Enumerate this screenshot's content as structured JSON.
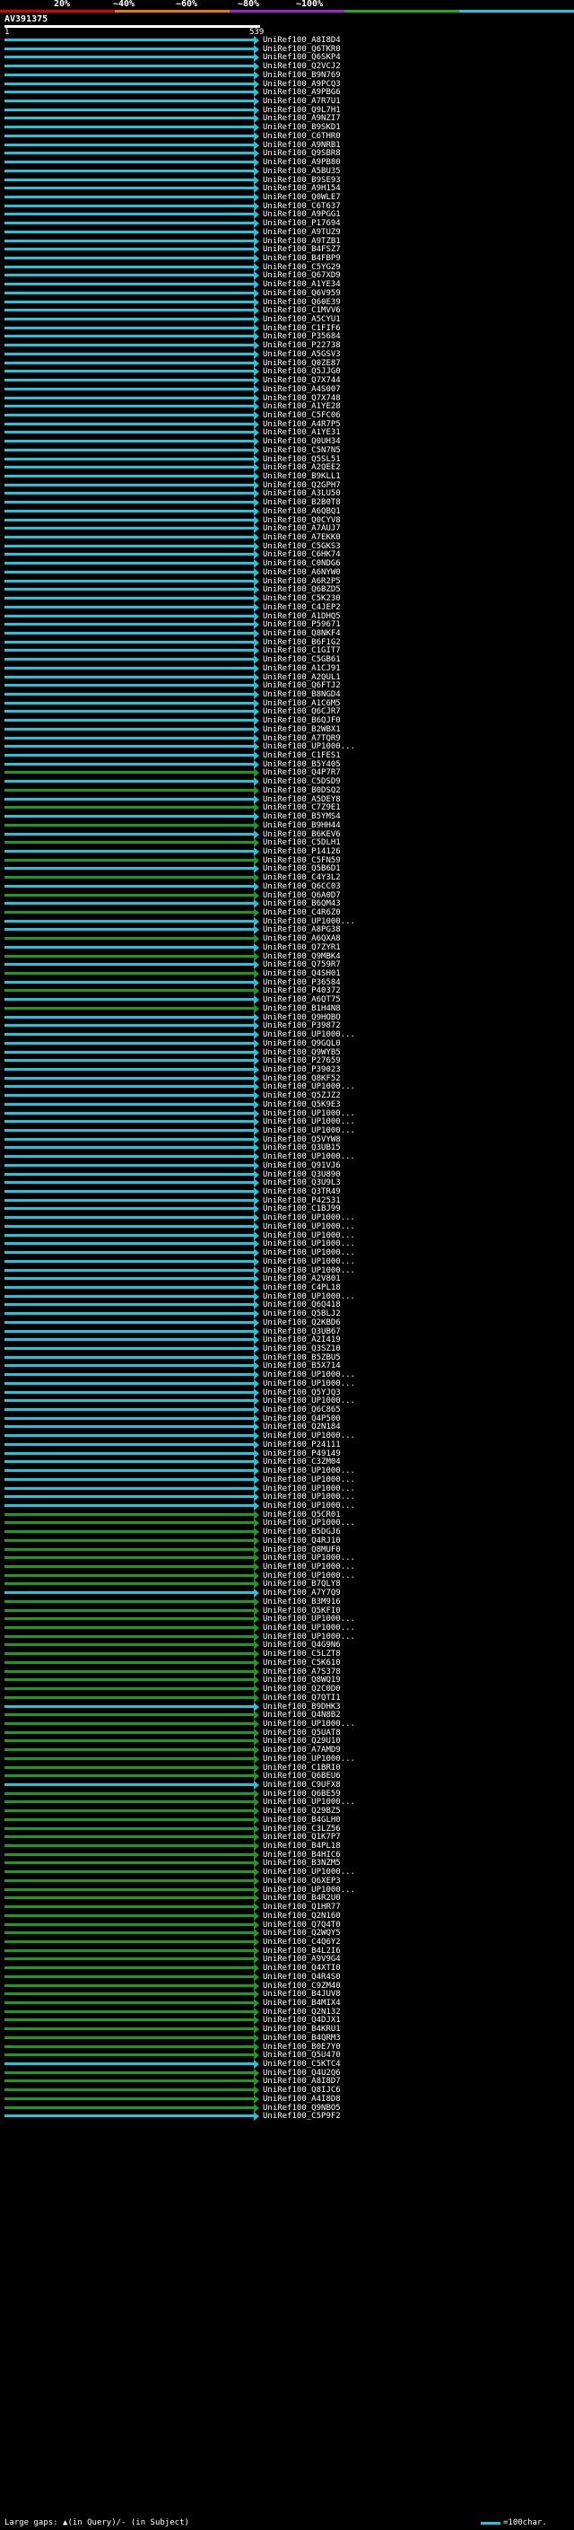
{
  "legend": {
    "labels": [
      "20%",
      "~40%",
      "~60%",
      "~80%",
      "~100%"
    ],
    "colors": [
      "#dd0000",
      "#ee7700",
      "#9922cc",
      "#22aa22",
      "#22c4dc"
    ]
  },
  "query": {
    "title": "AV391375",
    "start": "1",
    "end": "539"
  },
  "colors": {
    "cyan": "#22c4dc",
    "green": "#1f9a1f",
    "white": "#ffffff",
    "black": "#000000"
  },
  "hits": [
    {
      "label": "UniRef100_A8I8D4",
      "color": "cyan"
    },
    {
      "label": "UniRef100_Q6TKR0",
      "color": "cyan"
    },
    {
      "label": "UniRef100_Q6SKP4",
      "color": "cyan"
    },
    {
      "label": "UniRef100_Q2VCJ2",
      "color": "cyan"
    },
    {
      "label": "UniRef100_B9N769",
      "color": "cyan"
    },
    {
      "label": "UniRef100_A9PCQ3",
      "color": "cyan"
    },
    {
      "label": "UniRef100_A9PBG6",
      "color": "cyan"
    },
    {
      "label": "UniRef100_A7R7U1",
      "color": "cyan"
    },
    {
      "label": "UniRef100_Q9L7H1",
      "color": "cyan"
    },
    {
      "label": "UniRef100_A9NZI7",
      "color": "cyan"
    },
    {
      "label": "UniRef100_B9SKD1",
      "color": "cyan"
    },
    {
      "label": "UniRef100_C6THR0",
      "color": "cyan"
    },
    {
      "label": "UniRef100_A9NRB1",
      "color": "cyan"
    },
    {
      "label": "UniRef100_Q9SBR8",
      "color": "cyan"
    },
    {
      "label": "UniRef100_A9PB80",
      "color": "cyan"
    },
    {
      "label": "UniRef100_A5BU35",
      "color": "cyan"
    },
    {
      "label": "UniRef100_B9SE93",
      "color": "cyan"
    },
    {
      "label": "UniRef100_A9H154",
      "color": "cyan"
    },
    {
      "label": "UniRef100_Q0WLE7",
      "color": "cyan"
    },
    {
      "label": "UniRef100_C6T637",
      "color": "cyan"
    },
    {
      "label": "UniRef100_A9PGG1",
      "color": "cyan"
    },
    {
      "label": "UniRef100_P17694",
      "color": "cyan"
    },
    {
      "label": "UniRef100_A9TUZ9",
      "color": "cyan"
    },
    {
      "label": "UniRef100_A9TZB1",
      "color": "cyan"
    },
    {
      "label": "UniRef100_B4FSZ7",
      "color": "cyan"
    },
    {
      "label": "UniRef100_B4FBP9",
      "color": "cyan"
    },
    {
      "label": "UniRef100_C5YG29",
      "color": "cyan"
    },
    {
      "label": "UniRef100_Q67XD9",
      "color": "cyan"
    },
    {
      "label": "UniRef100_A1YE34",
      "color": "cyan"
    },
    {
      "label": "UniRef100_Q6V959",
      "color": "cyan"
    },
    {
      "label": "UniRef100_Q60E39",
      "color": "cyan"
    },
    {
      "label": "UniRef100_C1MVV6",
      "color": "cyan"
    },
    {
      "label": "UniRef100_A5CYU1",
      "color": "cyan"
    },
    {
      "label": "UniRef100_C1FIF6",
      "color": "cyan"
    },
    {
      "label": "UniRef100_P35684",
      "color": "cyan"
    },
    {
      "label": "UniRef100_P22738",
      "color": "cyan"
    },
    {
      "label": "UniRef100_A5GSV3",
      "color": "cyan"
    },
    {
      "label": "UniRef100_Q0ZE87",
      "color": "cyan"
    },
    {
      "label": "UniRef100_Q5JJG0",
      "color": "cyan"
    },
    {
      "label": "UniRef100_Q7X744",
      "color": "cyan"
    },
    {
      "label": "UniRef100_A4S007",
      "color": "cyan"
    },
    {
      "label": "UniRef100_Q7X748",
      "color": "cyan"
    },
    {
      "label": "UniRef100_A1YE28",
      "color": "cyan"
    },
    {
      "label": "UniRef100_C5FC06",
      "color": "cyan"
    },
    {
      "label": "UniRef100_A4R7P5",
      "color": "cyan"
    },
    {
      "label": "UniRef100_A1YE31",
      "color": "cyan"
    },
    {
      "label": "UniRef100_Q0UH34",
      "color": "cyan"
    },
    {
      "label": "UniRef100_C5N7N5",
      "color": "cyan"
    },
    {
      "label": "UniRef100_Q5SL51",
      "color": "cyan"
    },
    {
      "label": "UniRef100_A2QEE2",
      "color": "cyan"
    },
    {
      "label": "UniRef100_B9KLL1",
      "color": "cyan"
    },
    {
      "label": "UniRef100_Q2GPH7",
      "color": "cyan"
    },
    {
      "label": "UniRef100_A3LU50",
      "color": "cyan"
    },
    {
      "label": "UniRef100_B2B0T8",
      "color": "cyan"
    },
    {
      "label": "UniRef100_A6QBQ1",
      "color": "cyan"
    },
    {
      "label": "UniRef100_Q0CYV8",
      "color": "cyan"
    },
    {
      "label": "UniRef100_A7AUJ7",
      "color": "cyan"
    },
    {
      "label": "UniRef100_A7EKK0",
      "color": "cyan"
    },
    {
      "label": "UniRef100_C5GKS3",
      "color": "cyan"
    },
    {
      "label": "UniRef100_C6HK74",
      "color": "cyan"
    },
    {
      "label": "UniRef100_C0NDG6",
      "color": "cyan"
    },
    {
      "label": "UniRef100_A6NYW0",
      "color": "cyan"
    },
    {
      "label": "UniRef100_A6R2P5",
      "color": "cyan"
    },
    {
      "label": "UniRef100_Q6BZD5",
      "color": "cyan"
    },
    {
      "label": "UniRef100_C5K230",
      "color": "cyan"
    },
    {
      "label": "UniRef100_C4JEP2",
      "color": "cyan"
    },
    {
      "label": "UniRef100_A1DHQ5",
      "color": "cyan"
    },
    {
      "label": "UniRef100_P59671",
      "color": "cyan"
    },
    {
      "label": "UniRef100_Q8NKF4",
      "color": "cyan"
    },
    {
      "label": "UniRef100_B6F1G2",
      "color": "cyan"
    },
    {
      "label": "UniRef100_C1GIT7",
      "color": "cyan"
    },
    {
      "label": "UniRef100_C5GB61",
      "color": "cyan"
    },
    {
      "label": "UniRef100_A1CJ91",
      "color": "cyan"
    },
    {
      "label": "UniRef100_A2QUL1",
      "color": "cyan"
    },
    {
      "label": "UniRef100_Q6FTJ2",
      "color": "cyan"
    },
    {
      "label": "UniRef100_B8NGD4",
      "color": "cyan"
    },
    {
      "label": "UniRef100_A1C6M5",
      "color": "cyan"
    },
    {
      "label": "UniRef100_Q6CJR7",
      "color": "cyan"
    },
    {
      "label": "UniRef100_B6QJF0",
      "color": "cyan"
    },
    {
      "label": "UniRef100_B2WBX1",
      "color": "cyan"
    },
    {
      "label": "UniRef100_A7TQR9",
      "color": "cyan"
    },
    {
      "label": "UniRef100_UP1000...",
      "color": "cyan"
    },
    {
      "label": "UniRef100_C1FES1",
      "color": "cyan"
    },
    {
      "label": "UniRef100_B5Y405",
      "color": "cyan"
    },
    {
      "label": "UniRef100_Q4P7R7",
      "color": "green"
    },
    {
      "label": "UniRef100_C5DSD9",
      "color": "cyan"
    },
    {
      "label": "UniRef100_B0DSQ2",
      "color": "green"
    },
    {
      "label": "UniRef100_A5DEY8",
      "color": "cyan"
    },
    {
      "label": "UniRef100_C7Z9E1",
      "color": "green"
    },
    {
      "label": "UniRef100_B5YMS4",
      "color": "cyan"
    },
    {
      "label": "UniRef100_B9HH44",
      "color": "green"
    },
    {
      "label": "UniRef100_B6KEV6",
      "color": "cyan"
    },
    {
      "label": "UniRef100_C5DLH1",
      "color": "green"
    },
    {
      "label": "UniRef100_P14126",
      "color": "cyan"
    },
    {
      "label": "UniRef100_C5FN59",
      "color": "green"
    },
    {
      "label": "UniRef100_Q5B6D1",
      "color": "cyan"
    },
    {
      "label": "UniRef100_C4Y3L2",
      "color": "green"
    },
    {
      "label": "UniRef100_Q6CC03",
      "color": "cyan"
    },
    {
      "label": "UniRef100_Q6A0D7",
      "color": "green"
    },
    {
      "label": "UniRef100_B6QM43",
      "color": "cyan"
    },
    {
      "label": "UniRef100_C4R6Z0",
      "color": "green"
    },
    {
      "label": "UniRef100_UP1000...",
      "color": "cyan"
    },
    {
      "label": "UniRef100_A8PG38",
      "color": "cyan"
    },
    {
      "label": "UniRef100_A6QXA8",
      "color": "green"
    },
    {
      "label": "UniRef100_Q7ZYR1",
      "color": "cyan"
    },
    {
      "label": "UniRef100_Q9MBK4",
      "color": "green"
    },
    {
      "label": "UniRef100_Q759R7",
      "color": "cyan"
    },
    {
      "label": "UniRef100_Q4SH01",
      "color": "green"
    },
    {
      "label": "UniRef100_P36584",
      "color": "cyan"
    },
    {
      "label": "UniRef100_P40372",
      "color": "green"
    },
    {
      "label": "UniRef100_A6QT75",
      "color": "cyan"
    },
    {
      "label": "UniRef100_B1H4N8",
      "color": "green"
    },
    {
      "label": "UniRef100_Q9HOBO",
      "color": "cyan"
    },
    {
      "label": "UniRef100_P39872",
      "color": "cyan"
    },
    {
      "label": "UniRef100_UP1000...",
      "color": "cyan"
    },
    {
      "label": "UniRef100_Q9GQL0",
      "color": "cyan"
    },
    {
      "label": "UniRef100_Q9WYB5",
      "color": "cyan"
    },
    {
      "label": "UniRef100_P27659",
      "color": "cyan"
    },
    {
      "label": "UniRef100_P39023",
      "color": "cyan"
    },
    {
      "label": "UniRef100_Q8KF52",
      "color": "cyan"
    },
    {
      "label": "UniRef100_UP1000...",
      "color": "cyan"
    },
    {
      "label": "UniRef100_Q5ZJZ2",
      "color": "cyan"
    },
    {
      "label": "UniRef100_Q5K9E3",
      "color": "cyan"
    },
    {
      "label": "UniRef100_UP1000...",
      "color": "cyan"
    },
    {
      "label": "UniRef100_UP1000...",
      "color": "cyan"
    },
    {
      "label": "UniRef100_UP1000...",
      "color": "cyan"
    },
    {
      "label": "UniRef100_Q5VYW8",
      "color": "cyan"
    },
    {
      "label": "UniRef100_Q3UB15",
      "color": "cyan"
    },
    {
      "label": "UniRef100_UP1000...",
      "color": "cyan"
    },
    {
      "label": "UniRef100_Q91VJ6",
      "color": "cyan"
    },
    {
      "label": "UniRef100_Q3U890",
      "color": "cyan"
    },
    {
      "label": "UniRef100_Q3U9L3",
      "color": "cyan"
    },
    {
      "label": "UniRef100_Q3TR49",
      "color": "cyan"
    },
    {
      "label": "UniRef100_P42531",
      "color": "cyan"
    },
    {
      "label": "UniRef100_C1BJ99",
      "color": "cyan"
    },
    {
      "label": "UniRef100_UP1000...",
      "color": "cyan"
    },
    {
      "label": "UniRef100_UP1000...",
      "color": "cyan"
    },
    {
      "label": "UniRef100_UP1000...",
      "color": "cyan"
    },
    {
      "label": "UniRef100_UP1000...",
      "color": "cyan"
    },
    {
      "label": "UniRef100_UP1000...",
      "color": "cyan"
    },
    {
      "label": "UniRef100_UP1000...",
      "color": "cyan"
    },
    {
      "label": "UniRef100_UP1000...",
      "color": "cyan"
    },
    {
      "label": "UniRef100_A2V801",
      "color": "cyan"
    },
    {
      "label": "UniRef100_C4PL18",
      "color": "cyan"
    },
    {
      "label": "UniRef100_UP1000...",
      "color": "cyan"
    },
    {
      "label": "UniRef100_Q6Q418",
      "color": "cyan"
    },
    {
      "label": "UniRef100_Q5BLJ2",
      "color": "cyan"
    },
    {
      "label": "UniRef100_Q2KBD6",
      "color": "cyan"
    },
    {
      "label": "UniRef100_Q3UB67",
      "color": "cyan"
    },
    {
      "label": "UniRef100_A2I419",
      "color": "cyan"
    },
    {
      "label": "UniRef100_Q3SZ10",
      "color": "cyan"
    },
    {
      "label": "UniRef100_B5ZBU5",
      "color": "cyan"
    },
    {
      "label": "UniRef100_B5X714",
      "color": "cyan"
    },
    {
      "label": "UniRef100_UP1000...",
      "color": "cyan"
    },
    {
      "label": "UniRef100_UP1000...",
      "color": "cyan"
    },
    {
      "label": "UniRef100_Q5YJQ3",
      "color": "cyan"
    },
    {
      "label": "UniRef100_UP1000...",
      "color": "cyan"
    },
    {
      "label": "UniRef100_Q6C865",
      "color": "cyan"
    },
    {
      "label": "UniRef100_Q4P500",
      "color": "cyan"
    },
    {
      "label": "UniRef100_Q2N184",
      "color": "cyan"
    },
    {
      "label": "UniRef100_UP1000...",
      "color": "cyan"
    },
    {
      "label": "UniRef100_P24111",
      "color": "cyan"
    },
    {
      "label": "UniRef100_P49149",
      "color": "cyan"
    },
    {
      "label": "UniRef100_C3ZM04",
      "color": "cyan"
    },
    {
      "label": "UniRef100_UP1000...",
      "color": "cyan"
    },
    {
      "label": "UniRef100_UP1000...",
      "color": "cyan"
    },
    {
      "label": "UniRef100_UP1000...",
      "color": "cyan"
    },
    {
      "label": "UniRef100_UP1000...",
      "color": "cyan"
    },
    {
      "label": "UniRef100_UP1000...",
      "color": "cyan"
    },
    {
      "label": "UniRef100_Q5CR01",
      "color": "green"
    },
    {
      "label": "UniRef100_UP1000...",
      "color": "green"
    },
    {
      "label": "UniRef100_B5DGJ6",
      "color": "green"
    },
    {
      "label": "UniRef100_Q4RJ10",
      "color": "green"
    },
    {
      "label": "UniRef100_Q8MUF0",
      "color": "green"
    },
    {
      "label": "UniRef100_UP1000...",
      "color": "green"
    },
    {
      "label": "UniRef100_UP1000...",
      "color": "green"
    },
    {
      "label": "UniRef100_UP1000...",
      "color": "green"
    },
    {
      "label": "UniRef100_B7QLY8",
      "color": "green"
    },
    {
      "label": "UniRef100_A7Y7Q9",
      "color": "cyan"
    },
    {
      "label": "UniRef100_B3M916",
      "color": "green"
    },
    {
      "label": "UniRef100_Q5KFI0",
      "color": "green"
    },
    {
      "label": "UniRef100_UP1000...",
      "color": "green"
    },
    {
      "label": "UniRef100_UP1000...",
      "color": "green"
    },
    {
      "label": "UniRef100_UP1000...",
      "color": "green"
    },
    {
      "label": "UniRef100_Q4G9N6",
      "color": "green"
    },
    {
      "label": "UniRef100_C5LZT8",
      "color": "green"
    },
    {
      "label": "UniRef100_C5K610",
      "color": "green"
    },
    {
      "label": "UniRef100_A7S378",
      "color": "green"
    },
    {
      "label": "UniRef100_Q8WQ19",
      "color": "green"
    },
    {
      "label": "UniRef100_Q2C0D0",
      "color": "green"
    },
    {
      "label": "UniRef100_Q7QTI1",
      "color": "green"
    },
    {
      "label": "UniRef100_B9DHK3",
      "color": "cyan"
    },
    {
      "label": "UniRef100_Q4N8B2",
      "color": "green"
    },
    {
      "label": "UniRef100_UP1000...",
      "color": "green"
    },
    {
      "label": "UniRef100_Q5UAT8",
      "color": "green"
    },
    {
      "label": "UniRef100_Q29U10",
      "color": "green"
    },
    {
      "label": "UniRef100_A7AMD9",
      "color": "green"
    },
    {
      "label": "UniRef100_UP1000...",
      "color": "green"
    },
    {
      "label": "UniRef100_C1BRI0",
      "color": "green"
    },
    {
      "label": "UniRef100_Q6BEU6",
      "color": "green"
    },
    {
      "label": "UniRef100_C9UFX8",
      "color": "cyan"
    },
    {
      "label": "UniRef100_Q6BE59",
      "color": "green"
    },
    {
      "label": "UniRef100_UP1000...",
      "color": "green"
    },
    {
      "label": "UniRef100_Q29BZ5",
      "color": "green"
    },
    {
      "label": "UniRef100_B4GLH0",
      "color": "green"
    },
    {
      "label": "UniRef100_C3LZ56",
      "color": "green"
    },
    {
      "label": "UniRef100_Q1K7P7",
      "color": "green"
    },
    {
      "label": "UniRef100_B4PL18",
      "color": "green"
    },
    {
      "label": "UniRef100_B4HIC6",
      "color": "green"
    },
    {
      "label": "UniRef100_B3NZM5",
      "color": "green"
    },
    {
      "label": "UniRef100_UP1000...",
      "color": "green"
    },
    {
      "label": "UniRef100_Q6XEP3",
      "color": "green"
    },
    {
      "label": "UniRef100_UP1000...",
      "color": "green"
    },
    {
      "label": "UniRef100_B4R2U0",
      "color": "green"
    },
    {
      "label": "UniRef100_Q1HR77",
      "color": "green"
    },
    {
      "label": "UniRef100_Q2N160",
      "color": "green"
    },
    {
      "label": "UniRef100_Q7Q4T0",
      "color": "green"
    },
    {
      "label": "UniRef100_Q2WQY5",
      "color": "green"
    },
    {
      "label": "UniRef100_C4Q6Y2",
      "color": "green"
    },
    {
      "label": "UniRef100_B4L2I6",
      "color": "green"
    },
    {
      "label": "UniRef100_A9V9G4",
      "color": "green"
    },
    {
      "label": "UniRef100_Q4XTI0",
      "color": "green"
    },
    {
      "label": "UniRef100_Q4R4S0",
      "color": "green"
    },
    {
      "label": "UniRef100_C9ZM40",
      "color": "green"
    },
    {
      "label": "UniRef100_B4JUV8",
      "color": "green"
    },
    {
      "label": "UniRef100_B4MIX4",
      "color": "green"
    },
    {
      "label": "UniRef100_Q2N132",
      "color": "green"
    },
    {
      "label": "UniRef100_Q4DJX1",
      "color": "green"
    },
    {
      "label": "UniRef100_B4KRU1",
      "color": "green"
    },
    {
      "label": "UniRef100_B4QRM3",
      "color": "green"
    },
    {
      "label": "UniRef100_B0E7Y0",
      "color": "green"
    },
    {
      "label": "UniRef100_Q5U470",
      "color": "green"
    },
    {
      "label": "UniRef100_C5KTC4",
      "color": "cyan"
    },
    {
      "label": "UniRef100_Q4U2Q6",
      "color": "green"
    },
    {
      "label": "UniRef100_A8I8D7",
      "color": "green"
    },
    {
      "label": "UniRef100_Q8IJC6",
      "color": "green"
    },
    {
      "label": "UniRef100_A4I8D8",
      "color": "green"
    },
    {
      "label": "UniRef100_Q9NBO5",
      "color": "green"
    },
    {
      "label": "UniRef100_C5P9F2",
      "color": "cyan"
    }
  ],
  "footer": {
    "gaps_text": "Large gaps: ▲(in Query)/- (in Subject)",
    "scale_text": "=100char."
  }
}
